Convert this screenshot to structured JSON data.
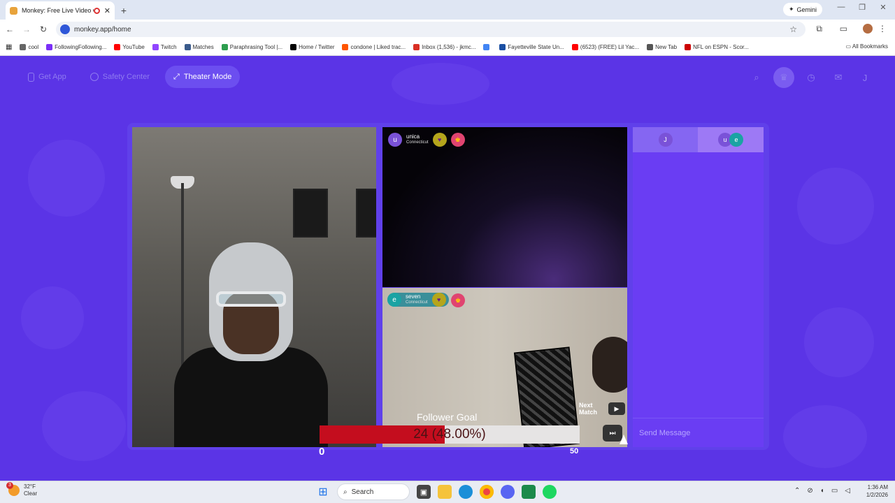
{
  "browser": {
    "tab_title": "Monkey: Free Live Video Ch",
    "tab_close": "✕",
    "new_tab": "+",
    "gemini_label": "Gemini",
    "url": "monkey.app/home",
    "bookmarks": [
      {
        "label": "cool",
        "color": "#666666"
      },
      {
        "label": "FollowingFollowing...",
        "color": "#7b2ff7"
      },
      {
        "label": "YouTube",
        "color": "#ff0000"
      },
      {
        "label": "Twitch",
        "color": "#9146ff"
      },
      {
        "label": "Matches",
        "color": "#3b5b8c"
      },
      {
        "label": "Paraphrasing Tool |...",
        "color": "#2e9e4f"
      },
      {
        "label": "Home / Twitter",
        "color": "#000000"
      },
      {
        "label": "condone | Liked trac...",
        "color": "#ff5500"
      },
      {
        "label": "Inbox (1,536) - jkmc...",
        "color": "#d93025"
      },
      {
        "label": "",
        "color": "#4285f4"
      },
      {
        "label": "Fayetteville State Un...",
        "color": "#1a4fa3"
      },
      {
        "label": "(6523) (FREE) Lil Yac...",
        "color": "#ff0000"
      },
      {
        "label": "New Tab",
        "color": "#555555"
      },
      {
        "label": "NFL on ESPN - Scor...",
        "color": "#cc0000"
      }
    ],
    "all_bookmarks": "All Bookmarks"
  },
  "app": {
    "nav": {
      "get_app": "Get App",
      "safety_center": "Safety Center",
      "theater_mode": "Theater Mode"
    },
    "profile_initial": "J",
    "user1": {
      "avatar": "u",
      "name": "unica",
      "location": "Connecticut"
    },
    "user2": {
      "avatar": "e",
      "name": "seven",
      "location": "Connecticut"
    },
    "next_match": "Next Match",
    "follower_goal": {
      "title": "Follower Goal",
      "current": 24,
      "goal": 50,
      "percent": 48.0,
      "label": "24 (48.00%)",
      "min_label": "0",
      "max_label": "50"
    },
    "chat": {
      "tab1_initial": "J",
      "tab2_initials": [
        "u",
        "e"
      ],
      "send_placeholder": "Send Message"
    }
  },
  "taskbar": {
    "weather_temp": "32°F",
    "weather_desc": "Clear",
    "weather_badge": "3",
    "search_label": "Search",
    "time": "1:36 AM",
    "date": "1/2/2026"
  }
}
